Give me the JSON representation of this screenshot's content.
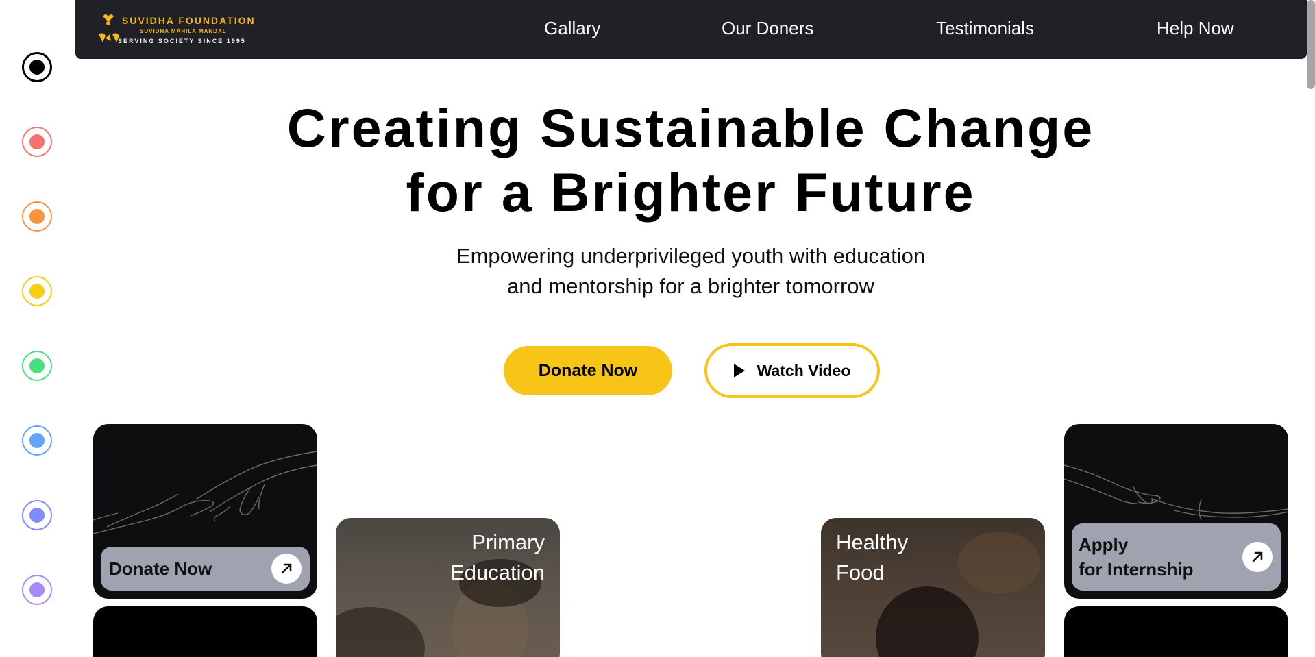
{
  "theme_colors": [
    "#000000",
    "#f87171",
    "#fb923c",
    "#facc15",
    "#4ade80",
    "#60a5fa",
    "#818cf8",
    "#a78bfa"
  ],
  "logo": {
    "line1": "SUVIDHA FOUNDATION",
    "line2": "SUVIDHA MAHILA MANDAL",
    "line3": "SERVING SOCIETY SINCE 1995",
    "mark_text": "SUVIDHA FOUNDATION"
  },
  "nav": {
    "gallery": "Gallary",
    "donors": "Our Doners",
    "testimonials": "Testimonials",
    "help": "Help Now"
  },
  "hero": {
    "title_line1": "Creating Sustainable Change",
    "title_line2": "for a Brighter Future",
    "subtitle_line1": "Empowering underprivileged youth with education",
    "subtitle_line2": "and mentorship for a brighter tomorrow",
    "donate_label": "Donate Now",
    "watch_label": "Watch Video"
  },
  "cards": {
    "donate": "Donate Now",
    "primary_line1": "Primary",
    "primary_line2": "Education",
    "healthy_line1": "Healthy",
    "healthy_line2": "Food",
    "internship_line1": "Apply",
    "internship_line2": "for Internship"
  },
  "icons": {
    "arrow": "arrow-up-right-icon",
    "play": "play-icon"
  }
}
